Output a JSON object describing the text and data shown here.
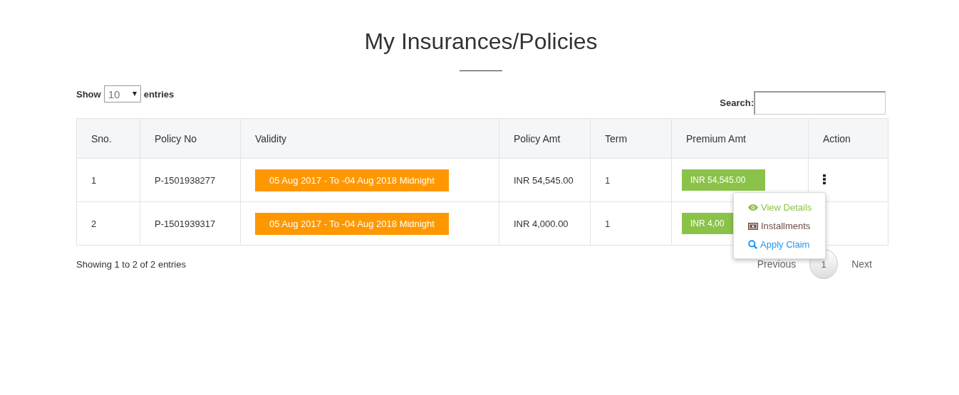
{
  "title": "My Insurances/Policies",
  "length_control": {
    "label_before": "Show",
    "value": "10",
    "label_after": "entries"
  },
  "search": {
    "label": "Search:"
  },
  "table": {
    "columns": [
      "Sno.",
      "Policy No",
      "Validity",
      "Policy Amt",
      "Term",
      "Premium Amt",
      "Action"
    ],
    "rows": [
      {
        "sno": "1",
        "policy_no": "P-1501938277",
        "validity": "05 Aug 2017 - To -04 Aug 2018 Midnight",
        "policy_amt": "INR 54,545.00",
        "term": "1",
        "premium_amt": "INR 54,545.00"
      },
      {
        "sno": "2",
        "policy_no": "P-1501939317",
        "validity": "05 Aug 2017 - To -04 Aug 2018 Midnight",
        "policy_amt": "INR 4,000.00",
        "term": "1",
        "premium_amt": "INR 4,00"
      }
    ]
  },
  "action_menu": [
    {
      "kind": "view",
      "label": "View Details"
    },
    {
      "kind": "installments",
      "label": "Installments"
    },
    {
      "kind": "claim",
      "label": "Apply Claim"
    }
  ],
  "info": "Showing 1 to 2 of 2 entries",
  "pagination": [
    {
      "label": "Previous",
      "selected": false
    },
    {
      "label": "1",
      "selected": true
    },
    {
      "label": "Next",
      "selected": false
    }
  ]
}
